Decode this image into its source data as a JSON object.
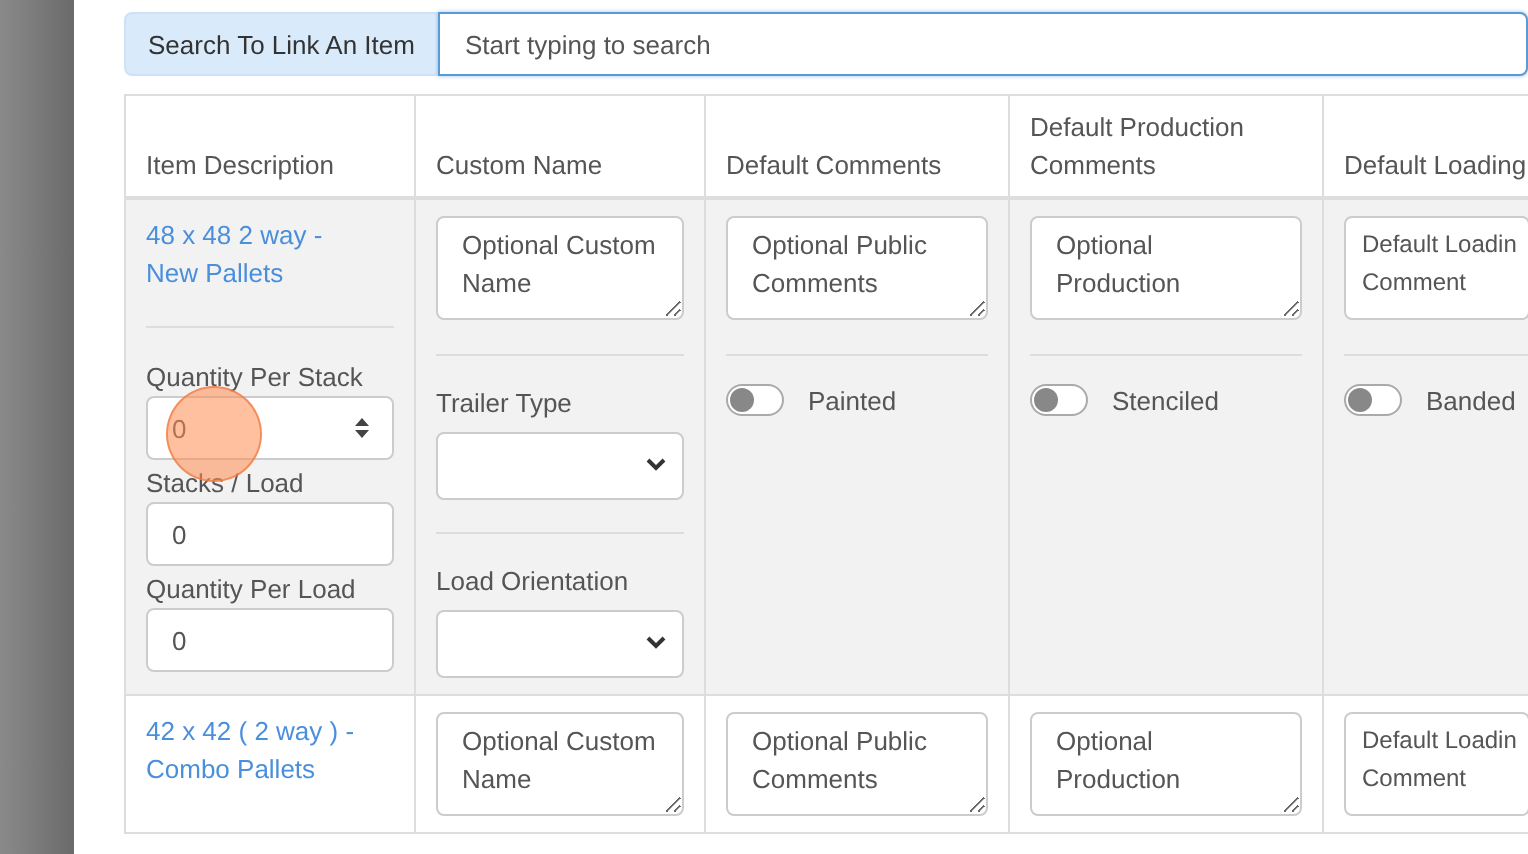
{
  "search": {
    "label": "Search To Link An Item",
    "placeholder": "Start typing to search"
  },
  "table": {
    "columns": [
      "Item Description",
      "Custom Name",
      "Default Comments",
      "Default Production Comments",
      "Default Loading"
    ],
    "rows": [
      {
        "item": "48 x 48 2 way - New Pallets",
        "custom_name": {
          "placeholder": "Optional Custom Name"
        },
        "public_comments": {
          "placeholder": "Optional Public Comments"
        },
        "production_comments": {
          "placeholder": "Optional Production"
        },
        "loading_comment": {
          "placeholder": "Default Loadin Comment"
        },
        "quantities": [
          {
            "label": "Quantity Per Stack",
            "value": "0"
          },
          {
            "label": "Stacks / Load",
            "value": "0"
          },
          {
            "label": "Quantity Per Load",
            "value": "0"
          }
        ],
        "selects": [
          {
            "label": "Trailer Type"
          },
          {
            "label": "Load Orientation"
          }
        ],
        "toggles": [
          {
            "label": "Painted",
            "on": false
          },
          {
            "label": "Stenciled",
            "on": false
          },
          {
            "label": "Banded",
            "on": false
          }
        ]
      },
      {
        "item": "42 x 42 ( 2 way ) - Combo Pallets",
        "custom_name": {
          "placeholder": "Optional Custom Name"
        },
        "public_comments": {
          "placeholder": "Optional Public Comments"
        },
        "production_comments": {
          "placeholder": "Optional Production"
        },
        "loading_comment": {
          "placeholder": "Default Loadin Comment"
        }
      }
    ]
  }
}
